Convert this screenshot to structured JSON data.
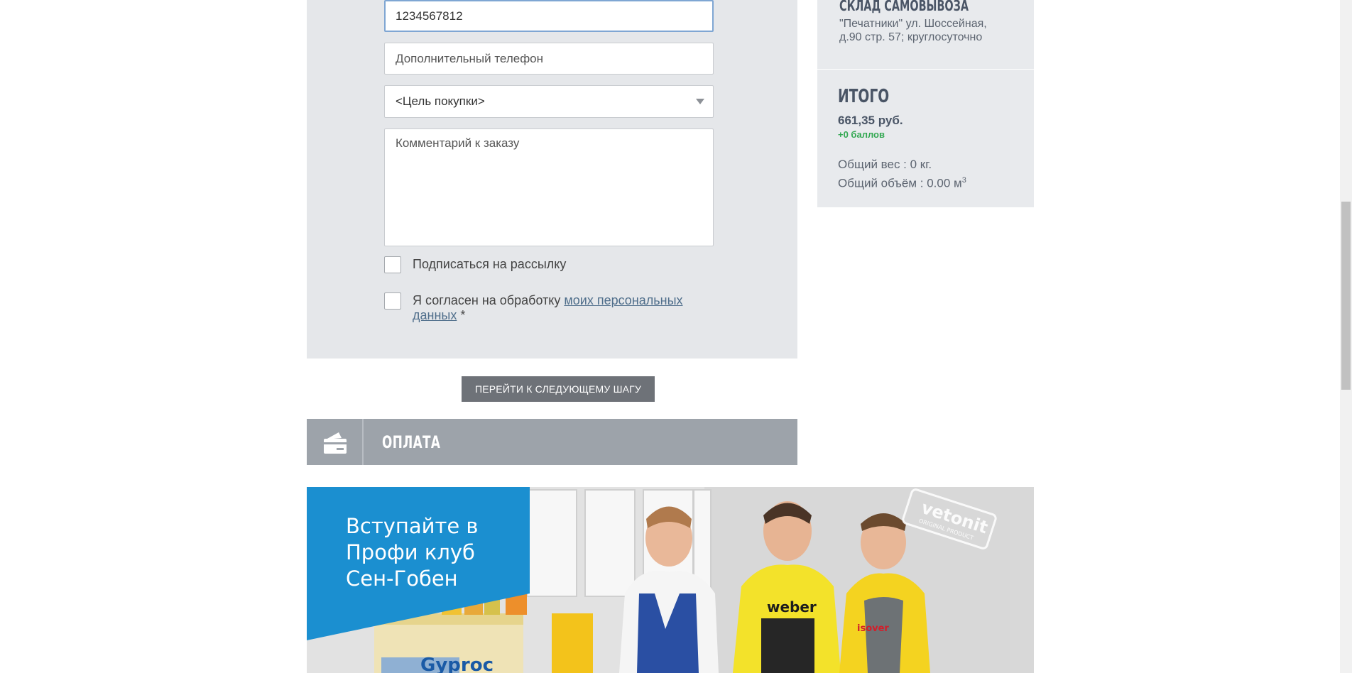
{
  "form": {
    "phone_value": "1234567812",
    "extra_phone_placeholder": "Дополнительный телефон",
    "purpose_selected": "<Цель покупки>",
    "comment_placeholder": "Комментарий к заказу",
    "subscribe_label": "Подписаться на рассылку",
    "consent_prefix": "Я согласен на обработку ",
    "consent_link": "моих персональных данных",
    "consent_suffix": " *"
  },
  "next_button_label": "ПЕРЕЙТИ К СЛЕДУЮЩЕМУ ШАГУ",
  "payment": {
    "title": "ОПЛАТА",
    "icon": "wallet-card-icon"
  },
  "summary": {
    "pickup_heading": "СКЛАД САМОВЫВОЗА",
    "pickup_address": "\"Печатники\" ул. Шоссейная, д.90 стр. 57; круглосуточно",
    "total_heading": "ИТОГО",
    "total_price": "661,35 руб.",
    "bonus": "+0 баллов",
    "weight": "Общий вес : 0 кг.",
    "volume": "Общий объём : 0.00 м",
    "volume_sup": "3"
  },
  "banner": {
    "headline_1": "Вступайте в",
    "headline_2": "Профи клуб",
    "headline_3": "Сен-Гобен",
    "brand_vetonit": "vetonit",
    "brand_vetonit_sub": "ORIGINAL PRODUCT",
    "brand_weber": "weber",
    "brand_isover": "isover",
    "brand_gyproc": "Gyproc"
  },
  "colors": {
    "accent_blue": "#1b8fd0",
    "panel": "#e5e7ea",
    "button": "#6e7278",
    "bonus_green": "#33a852"
  }
}
